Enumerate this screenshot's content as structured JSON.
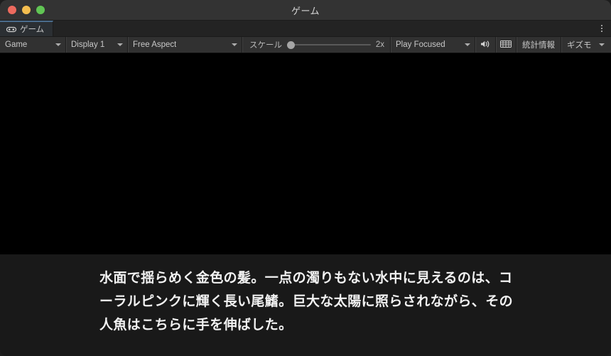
{
  "window": {
    "title": "ゲーム",
    "traffic_lights": [
      {
        "name": "close",
        "color": "#ed6a5e"
      },
      {
        "name": "minimize",
        "color": "#f4bd4f"
      },
      {
        "name": "zoom",
        "color": "#61c554"
      }
    ]
  },
  "tabbar": {
    "tab_label": "ゲーム",
    "tab_icon": "gamepad-icon",
    "overflow_icon": "kebab-menu-icon"
  },
  "toolbar": {
    "game_dropdown": "Game",
    "display_dropdown": "Display 1",
    "aspect_dropdown": "Free Aspect",
    "scale_label": "スケール",
    "scale_value": "2x",
    "play_mode_dropdown": "Play Focused",
    "mute_icon": "speaker-icon",
    "grid_icon": "grid-icon",
    "stats_label": "統計情報",
    "gizmos_label": "ギズモ"
  },
  "gameview": {
    "background": "#000000"
  },
  "subtitle": {
    "line1": "水面で揺らめく金色の髪。一点の濁りもない水中に見えるの",
    "line2": "は、コーラルピンクに輝く長い尾鰭。巨大な太陽に照らされ",
    "line3": "ながら、その人魚はこちらに手を伸ばした。",
    "full_text": "水面で揺らめく金色の髪。一点の濁りもない水中に見えるのは、コーラルピンクに輝く長い尾鰭。巨大な太陽に照らされながら、その人魚はこちらに手を伸ばした。"
  }
}
